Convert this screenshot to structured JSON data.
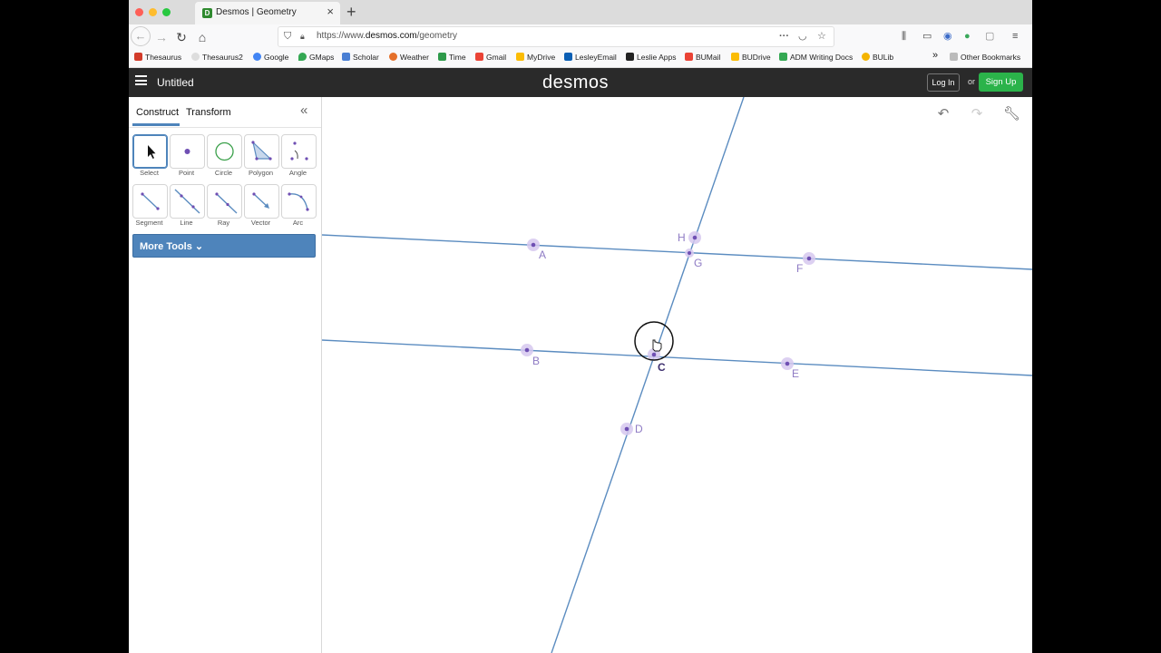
{
  "browser": {
    "tab_title": "Desmos | Geometry",
    "url_prefix": "https://www.",
    "url_domain": "desmos.com",
    "url_path": "/geometry",
    "bookmarks": [
      "Thesaurus",
      "Thesaurus2",
      "Google",
      "GMaps",
      "Scholar",
      "Weather",
      "Time",
      "Gmail",
      "MyDrive",
      "LesleyEmail",
      "Leslie Apps",
      "BUMail",
      "BUDrive",
      "ADM Writing Docs",
      "BULib"
    ],
    "other_bookmarks": "Other Bookmarks"
  },
  "app": {
    "title": "Untitled",
    "logo": "desmos",
    "login_label": "Log In",
    "or_label": "or",
    "signup_label": "Sign Up"
  },
  "sidebar": {
    "tabs": [
      "Construct",
      "Transform"
    ],
    "tools": [
      "Select",
      "Point",
      "Circle",
      "Polygon",
      "Angle",
      "Segment",
      "Line",
      "Ray",
      "Vector",
      "Arc"
    ],
    "selected_tool": "Select",
    "more_tools_label": "More Tools"
  },
  "canvas": {
    "point_labels": [
      "A",
      "B",
      "C",
      "D",
      "E",
      "F",
      "G",
      "H"
    ]
  },
  "colors": {
    "line": "#5b8cc0",
    "point": "#6f4fb3",
    "point_halo": "#d6c8ef",
    "label": "#8e7bc4",
    "accent": "#4e84bb",
    "signup": "#2bb34a"
  }
}
